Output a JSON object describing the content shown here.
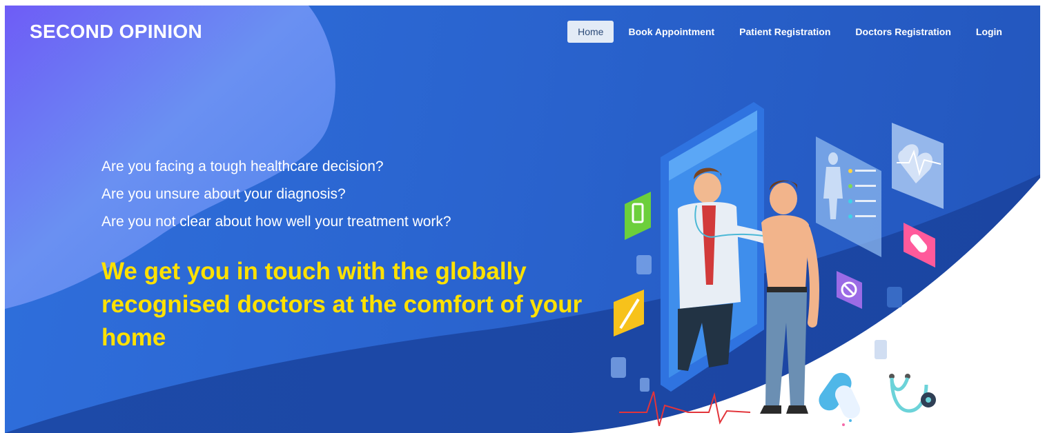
{
  "brand": {
    "name": "SECOND OPINION"
  },
  "nav": {
    "items": [
      {
        "label": "Home",
        "active": true
      },
      {
        "label": "Book Appointment",
        "active": false
      },
      {
        "label": "Patient Registration",
        "active": false
      },
      {
        "label": "Doctors Registration",
        "active": false
      },
      {
        "label": "Login",
        "active": false
      }
    ]
  },
  "hero": {
    "questions": [
      "Are you facing a tough healthcare decision?",
      "Are you unsure about your diagnosis?",
      "Are you not clear about how well your treatment work?"
    ],
    "headline": "We get you in touch with the globally recognised doctors at the comfort of your home"
  },
  "colors": {
    "hero_blue": "#2a64cf",
    "headline_yellow": "#ffe100",
    "nav_active_bg": "#e3ebf6"
  },
  "illustration": {
    "icons": [
      "smartphone-icon",
      "doctor-icon",
      "patient-icon",
      "stethoscope-icon",
      "pill-icon",
      "syringe-icon",
      "heartbeat-icon",
      "body-scan-icon"
    ]
  }
}
